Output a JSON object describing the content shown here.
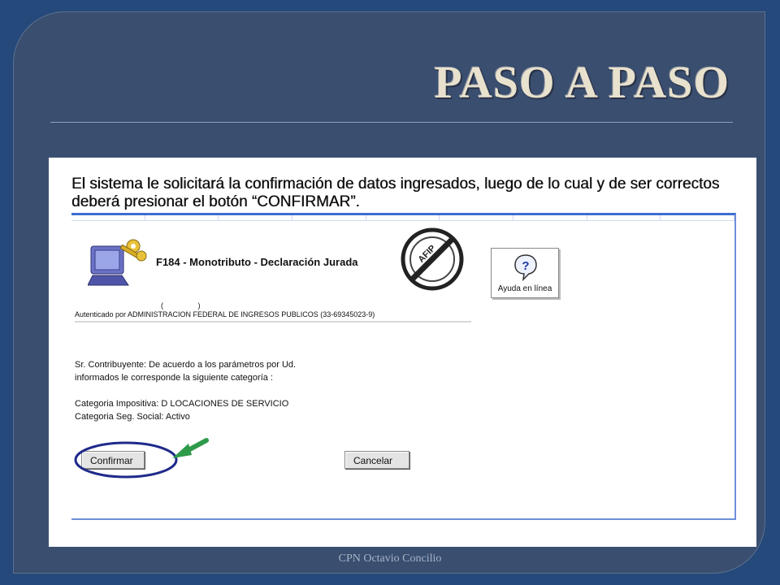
{
  "slide": {
    "title": "PASO A PASO",
    "instruction": "El sistema le solicitará la confirmación de datos ingresados, luego de lo cual y de ser correctos deberá presionar el botón “CONFIRMAR”.",
    "footer": "CPN Octavio Concilio"
  },
  "form": {
    "title": "F184 - Monotributo - Declaración Jurada",
    "help_label": "Ayuda en línea",
    "seal_text": "AFIP",
    "auth_parens": "( )",
    "auth_line": "Autenticado por ADMINISTRACION FEDERAL DE INGRESOS PUBLICOS (33-69345023-9)",
    "message_line1": "Sr. Contribuyente: De acuerdo a los parámetros por Ud.",
    "message_line2": "informados le corresponde la siguiente categoría :",
    "category_tax": "Categoria Impositiva: D LOCACIONES DE SERVICIO",
    "category_social": "Categoria Seg. Social: Activo",
    "confirm_label": "Confirmar",
    "cancel_label": "Cancelar"
  },
  "colors": {
    "background": "#24497a",
    "frame": "#3a4f70",
    "title": "#e8e1cd",
    "highlight_ellipse": "#1f2a8a",
    "arrow": "#2e9a4a"
  },
  "icons": [
    "computer-key-icon",
    "afip-seal-icon",
    "help-question-icon",
    "green-arrow-icon"
  ]
}
